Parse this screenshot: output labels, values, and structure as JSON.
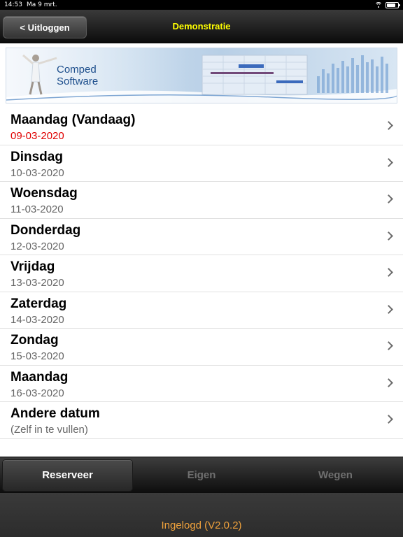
{
  "status_bar": {
    "time": "14:53",
    "date": "Ma 9 mrt.",
    "battery_level": 0.8
  },
  "nav": {
    "back_label": "< Uitloggen",
    "title": "Demonstratie"
  },
  "banner": {
    "line1": "Comped",
    "line2": "Software"
  },
  "days": [
    {
      "title": "Maandag (Vandaag)",
      "subtitle": "09-03-2020",
      "today": true
    },
    {
      "title": "Dinsdag",
      "subtitle": "10-03-2020"
    },
    {
      "title": "Woensdag",
      "subtitle": "11-03-2020"
    },
    {
      "title": "Donderdag",
      "subtitle": "12-03-2020"
    },
    {
      "title": "Vrijdag",
      "subtitle": "13-03-2020"
    },
    {
      "title": "Zaterdag",
      "subtitle": "14-03-2020"
    },
    {
      "title": "Zondag",
      "subtitle": "15-03-2020"
    },
    {
      "title": "Maandag",
      "subtitle": "16-03-2020"
    },
    {
      "title": "Andere datum",
      "subtitle": "(Zelf in te vullen)"
    }
  ],
  "tabs": [
    {
      "label": "Reserveer",
      "active": true
    },
    {
      "label": "Eigen",
      "active": false
    },
    {
      "label": "Wegen",
      "active": false
    }
  ],
  "footer": {
    "status": "Ingelogd (V2.0.2)"
  },
  "colors": {
    "nav_title": "#ffff00",
    "today_date": "#e00000",
    "footer_status": "#f0a23c"
  }
}
